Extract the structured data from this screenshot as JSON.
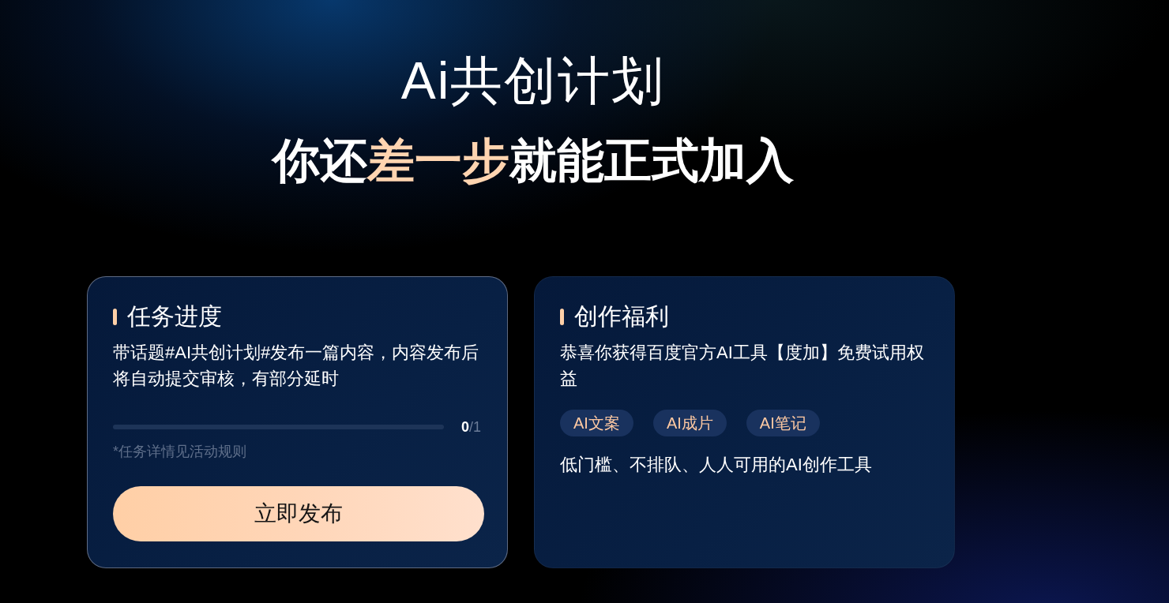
{
  "header": {
    "logo": "Ai共创计划",
    "headline": [
      {
        "text": "你还",
        "highlight": false
      },
      {
        "text": "差一步",
        "highlight": true
      },
      {
        "text": "就能正式加入",
        "highlight": false
      }
    ]
  },
  "cards": [
    {
      "kind": "task",
      "outlined": true,
      "title": "任务进度",
      "description": "带话题#AI共创计划#发布一篇内容，内容发布后将自动提交审核，有部分延时",
      "progress": {
        "level": 0,
        "done": "0",
        "total": "/1"
      },
      "note": "*任务详情见活动规则",
      "button": "立即发布"
    },
    {
      "kind": "benefit",
      "outlined": false,
      "title": "创作福利",
      "description": "恭喜你获得百度官方AI工具【度加】免费试用权益",
      "tags": [
        "AI文案",
        "AI成片",
        "AI笔记"
      ],
      "footer": "低门槛、不排队、人人可用的AI创作工具"
    }
  ]
}
